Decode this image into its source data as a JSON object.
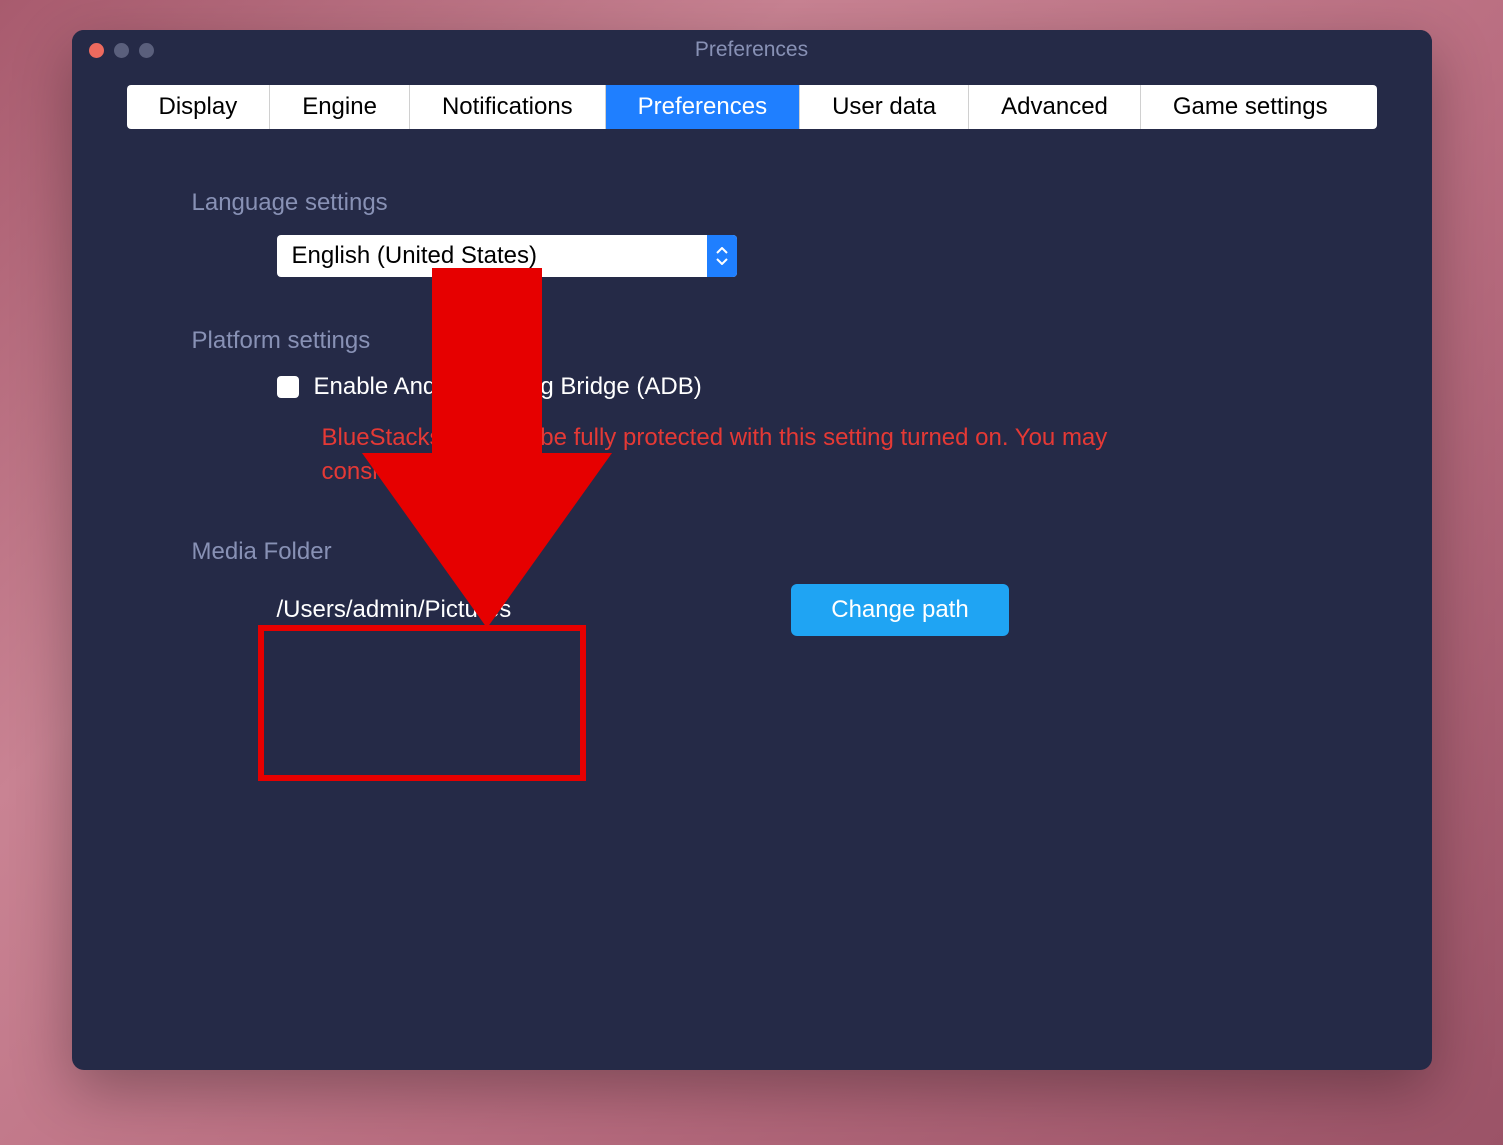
{
  "window": {
    "title": "Preferences"
  },
  "tabs": [
    {
      "label": "Display",
      "active": false
    },
    {
      "label": "Engine",
      "active": false
    },
    {
      "label": "Notifications",
      "active": false
    },
    {
      "label": "Preferences",
      "active": true
    },
    {
      "label": "User data",
      "active": false
    },
    {
      "label": "Advanced",
      "active": false
    },
    {
      "label": "Game settings",
      "active": false
    }
  ],
  "language": {
    "section_label": "Language settings",
    "selected": "English (United States)"
  },
  "platform": {
    "section_label": "Platform settings",
    "checkbox_label": "Enable Android Debug Bridge (ADB)",
    "warning": "BlueStacks may not be fully protected with this setting turned on. You may consider turning it off later"
  },
  "media": {
    "section_label": "Media Folder",
    "path": "/Users/admin/Pictures",
    "button_label": "Change path"
  }
}
